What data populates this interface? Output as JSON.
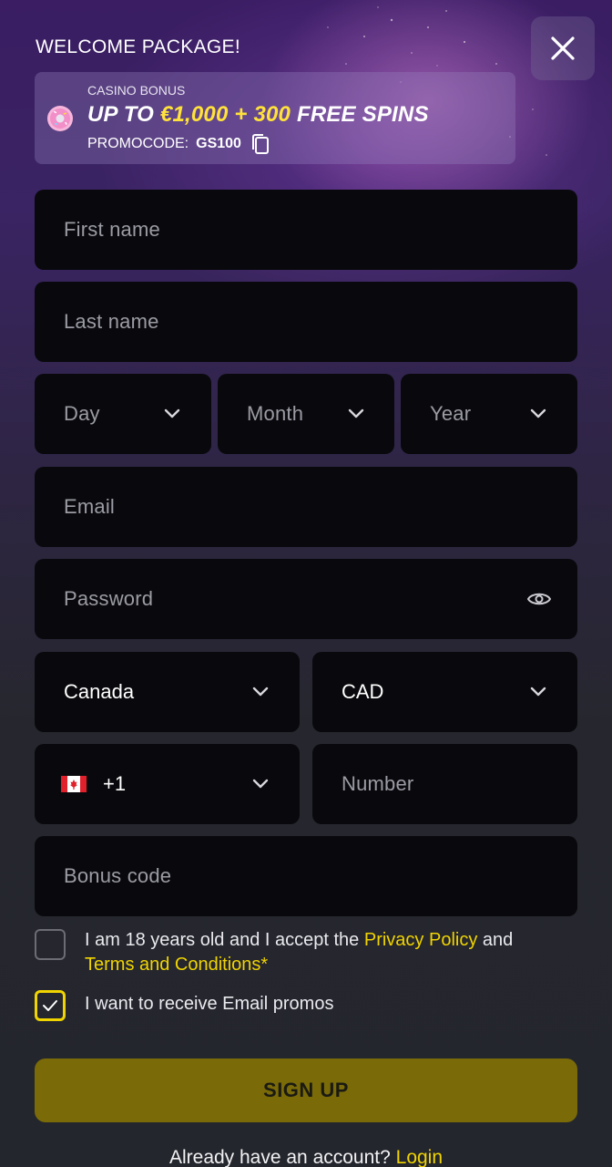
{
  "header": {
    "welcome": "WELCOME PACKAGE!"
  },
  "bonus": {
    "label": "CASINO BONUS",
    "headline_prefix": "UP TO ",
    "headline_amount": "€1,000 + 300",
    "headline_suffix": " FREE SPINS",
    "promo_label": "PROMOCODE:",
    "promo_code": "GS100"
  },
  "form": {
    "first_name_placeholder": "First name",
    "last_name_placeholder": "Last name",
    "day_placeholder": "Day",
    "month_placeholder": "Month",
    "year_placeholder": "Year",
    "email_placeholder": "Email",
    "password_placeholder": "Password",
    "country_value": "Canada",
    "currency_value": "CAD",
    "phone_code": "+1",
    "number_placeholder": "Number",
    "bonus_code_placeholder": "Bonus code"
  },
  "consent": {
    "age_text": "I am 18 years old and I accept the ",
    "privacy_link": "Privacy Policy",
    "and_text": " and",
    "terms_link": "Terms and Conditions*",
    "age_checked": false,
    "promos_text": "I want to receive Email promos",
    "promos_checked": true
  },
  "actions": {
    "signup_label": "SIGN UP",
    "login_prompt": "Already have an account? ",
    "login_link": "Login"
  },
  "colors": {
    "accent": "#f0d400",
    "button": "#7a6b08",
    "field_bg": "#09090d"
  }
}
